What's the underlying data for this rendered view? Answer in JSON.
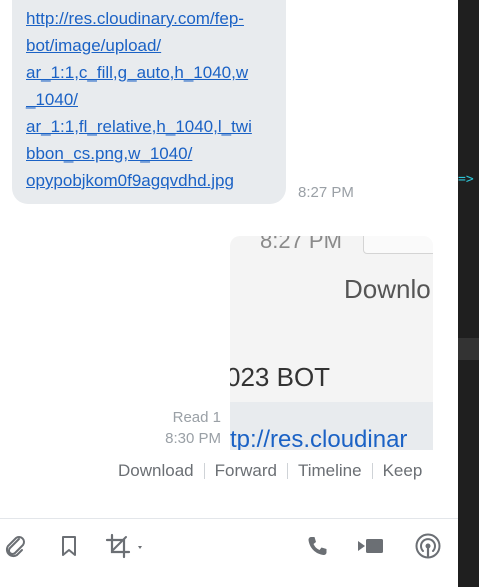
{
  "incoming_message": {
    "link_text": "http://res.cloudinary.com/fep-\nbot/image/upload/\nar_1:1,c_fill,g_auto,h_1040,w\n_1040/\nar_1:1,fl_relative,h_1040,l_twi\nbbon_cs.png,w_1040/\nopypobjkom0f9agqvdhd.jpg",
    "time": "8:27 PM"
  },
  "outgoing_message": {
    "image_preview": {
      "time_text": "8:27 PM",
      "download_text": "Downlo",
      "bot_text": "023 BOT",
      "url_text": "tp://res.cloudinar"
    },
    "read_status": "Read 1",
    "time": "8:30 PM"
  },
  "actions": {
    "download": "Download",
    "forward": "Forward",
    "timeline": "Timeline",
    "keep": "Keep"
  },
  "composer_icons": [
    "paperclip-icon",
    "bookmark-icon",
    "crop-icon",
    "phone-icon",
    "video-icon",
    "broadcast-icon"
  ],
  "side_pane": {
    "arrow_text": "=>"
  },
  "colors": {
    "link": "#1b62c5",
    "bubble_background": "#e8ebee",
    "muted_text": "#9aa0a6",
    "side_pane": "#1f1f1f",
    "side_accent": "#2ec4d6"
  }
}
